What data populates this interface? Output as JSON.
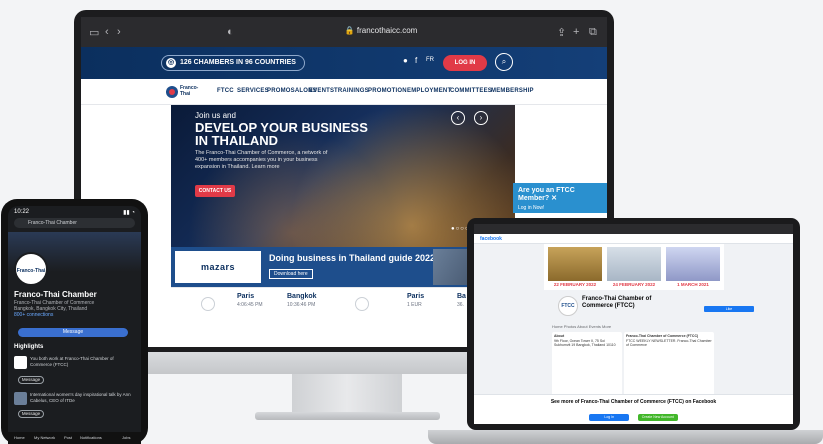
{
  "desktop": {
    "browser": {
      "url": "francothaicc.com"
    },
    "topbar": {
      "chambers": "126 CHAMBERS IN 96 COUNTRIES",
      "lang": "FR",
      "login": "LOG IN"
    },
    "nav": [
      "FTCC",
      "SERVICES",
      "PROMOSALONS",
      "EVENTS",
      "TRAININGS",
      "PROMOTION",
      "EMPLOYMENT",
      "COMMITTEES",
      "MEMBERSHIP"
    ],
    "logo": "Franco-Thai",
    "hero": {
      "pre": "Join us and",
      "title_1": "DEVELOP YOUR BUSINESS",
      "title_2": "IN THAILAND",
      "body": "The Franco-Thai Chamber of Commerce, a network of 400+ members accompanies you in your business expansion in Thailand. Learn more",
      "cta": "CONTACT US"
    },
    "member": {
      "title": "Are you an FTCC Member?",
      "sub": "Log in Now!"
    },
    "banner": {
      "brand": "mazars",
      "title": "Doing business in Thailand guide 2022",
      "button": "Download here"
    },
    "clocks": [
      {
        "city": "Paris",
        "time": "4:06:45 PM"
      },
      {
        "city": "Bangkok",
        "time": "10:36:46 PM"
      },
      {
        "city": "Paris",
        "time": "1 EUR"
      },
      {
        "city": "Ba",
        "time": "36."
      }
    ]
  },
  "phone": {
    "status_time": "10:22",
    "search": "Franco-Thai Chamber",
    "logo": "Franco-Thai",
    "name": "Franco-Thai Chamber",
    "sub_1": "Franco-Thai Chamber of Commerce",
    "sub_2": "Franco-Thai Chamber of Commerce",
    "sub_3": "Bangkok, Bangkok City, Thailand",
    "sub_4": "800+ connections",
    "message": "Message",
    "highlights": "Highlights",
    "post_1": "You both work at Franco-Thai Chamber of Commerce (FTCC)",
    "post_1_btn": "Message",
    "post_2": "International women's day inspirational talk by Ann Cabelus, CEO of ITDe",
    "post_2_btn": "Message",
    "tabs": [
      "Home",
      "My Network",
      "Post",
      "Notifications",
      "Jobs"
    ]
  },
  "laptop": {
    "brand": "facebook",
    "covers": [
      "22 FEBRUARY 2022",
      "24 FEBRUARY 2022",
      "1 MARCH 2021"
    ],
    "logo": "FTCC",
    "name": "Franco-Thai Chamber of Commerce (FTCC)",
    "like": "Like",
    "tabs": "Home  Photos  About  Events  More",
    "about_title": "About",
    "about_body": "9th Floor, Ocean Tower II, 75 Soi Sukhumvit 19 Bangkok, Thailand 10110",
    "posts_title": "Franco-Thai Chamber of Commerce (FTCC)",
    "posts_body": "FTCC WEEKLY NEWSLETTER. Franco-Thai Chamber of Commerce",
    "see_more": "See more of Franco-Thai Chamber of Commerce (FTCC) on Facebook",
    "login_btn": "Log In",
    "create_btn": "Create New Account"
  }
}
